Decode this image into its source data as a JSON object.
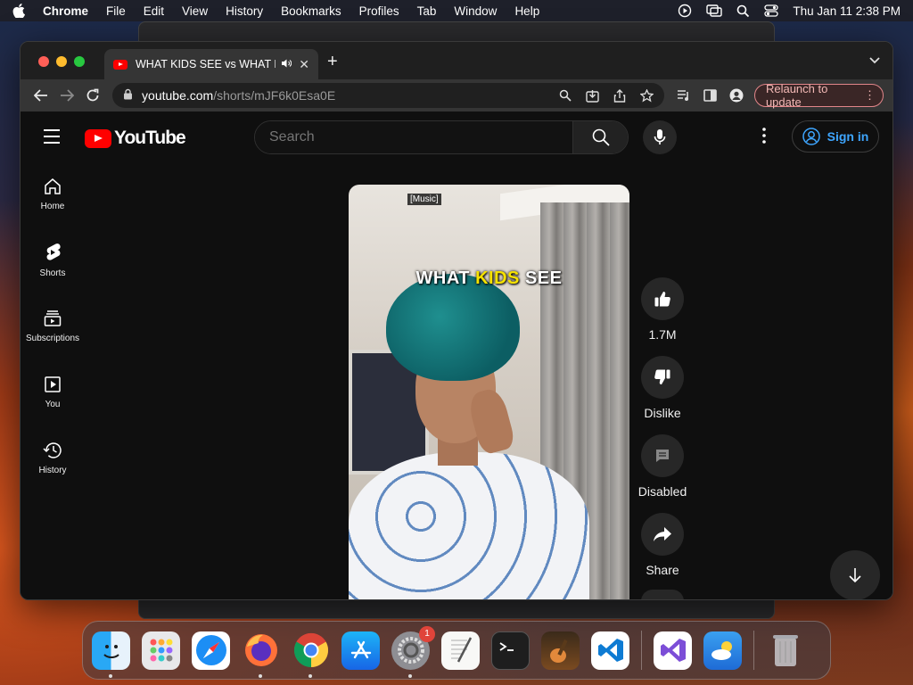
{
  "menubar": {
    "app_name": "Chrome",
    "items": [
      "File",
      "Edit",
      "View",
      "History",
      "Bookmarks",
      "Profiles",
      "Tab",
      "Window",
      "Help"
    ],
    "clock": "Thu Jan 11  2:38 PM"
  },
  "browser": {
    "tab_title": "WHAT KIDS SEE vs WHAT PARENTS SEE",
    "url_host": "youtube.com",
    "url_path": "/shorts/mJF6k0Esa0E",
    "relaunch_label": "Relaunch to update"
  },
  "youtube": {
    "logo_text": "YouTube",
    "search_placeholder": "Search",
    "sign_in_label": "Sign in",
    "sidebar": [
      {
        "label": "Home",
        "icon": "home-icon"
      },
      {
        "label": "Shorts",
        "icon": "shorts-icon"
      },
      {
        "label": "Subscriptions",
        "icon": "subscriptions-icon"
      },
      {
        "label": "You",
        "icon": "you-icon"
      },
      {
        "label": "History",
        "icon": "history-icon"
      }
    ],
    "short": {
      "caption_tag": "[Music]",
      "overlay_word1": "WHAT",
      "overlay_highlight": "KIDS",
      "overlay_word3": "SEE"
    },
    "actions": {
      "like_count": "1.7M",
      "dislike_label": "Dislike",
      "comments_label": "Disabled",
      "share_label": "Share"
    }
  },
  "dock": {
    "apps": [
      "Finder",
      "Launchpad",
      "Safari",
      "Firefox",
      "Chrome",
      "App Store",
      "System Settings",
      "TextEdit",
      "Terminal",
      "GarageBand",
      "Visual Studio Code",
      "Visual Studio",
      "Weather",
      "Trash"
    ],
    "settings_badge": "1"
  },
  "colors": {
    "youtube_red": "#ff0000",
    "link_blue": "#3ea6ff",
    "highlight_yellow": "#f6e200"
  }
}
